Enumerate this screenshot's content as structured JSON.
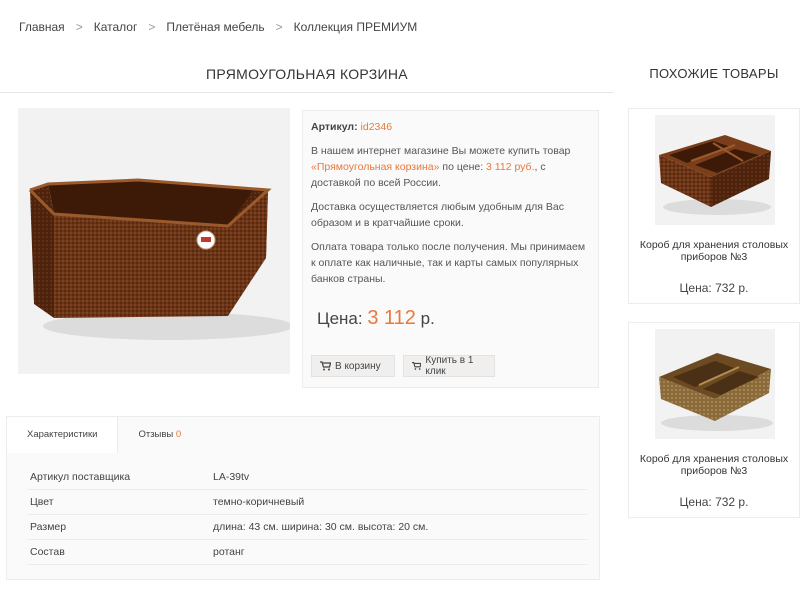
{
  "breadcrumb": {
    "items": [
      "Главная",
      "Каталог",
      "Плетёная мебель",
      "Коллекция ПРЕМИУМ"
    ],
    "separator": ">"
  },
  "product": {
    "title": "ПРЯМОУГОЛЬНАЯ КОРЗИНА",
    "sku_label": "Артикул:",
    "sku_value": "id2346",
    "desc1_a": "В нашем интернет магазине Вы можете купить товар ",
    "desc1_name": "«Прямоугольная корзина»",
    "desc1_b": " по цене: ",
    "desc1_price": "3 112 руб.",
    "desc1_c": ", с доставкой по всей России.",
    "desc2": "Доставка осуществляется любым удобным для Вас образом и в кратчайшие сроки.",
    "desc3": "Оплата товара только после получения. Мы принимаем к оплате как наличные, так и карты самых популярных банков страны.",
    "price_label": "Цена:",
    "price_value": "3 112",
    "price_unit": "р.",
    "add_to_cart": "В корзину",
    "buy_one_click": "Купить в 1 клик"
  },
  "tabs": {
    "specs": "Характеристики",
    "reviews": "Отзывы",
    "reviews_count": "0"
  },
  "specs": [
    {
      "key": "Артикул поставщика",
      "value": "LA-39tv"
    },
    {
      "key": "Цвет",
      "value": "темно-коричневый"
    },
    {
      "key": "Размер",
      "value": "длина: 43 см. ширина: 30 см. высота: 20 см."
    },
    {
      "key": "Состав",
      "value": "ротанг"
    }
  ],
  "related": {
    "title": "ПОХОЖИЕ ТОВАРЫ",
    "items": [
      {
        "name": "Короб для хранения столовых приборов №3",
        "price": "Цена: 732 р."
      },
      {
        "name": "Короб для хранения столовых приборов №3",
        "price": "Цена: 732 р."
      }
    ]
  },
  "colors": {
    "accent": "#e8793a",
    "wicker_dark": "#5a2a12",
    "wicker_light": "#a0643a"
  }
}
